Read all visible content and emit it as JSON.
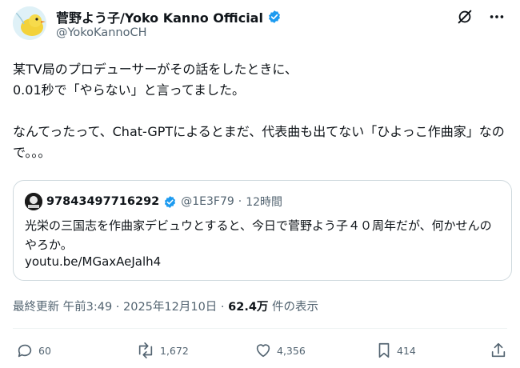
{
  "author": {
    "display_name": "菅野よう子/Yoko Kanno Official",
    "handle": "@YokoKannoCH",
    "avatar_icon": "yellow-bird-avatar",
    "verified_color": "#1d9bf0"
  },
  "header_icons": [
    "grok-icon",
    "more-icon"
  ],
  "post": {
    "text": "某TV局のプロデューサーがその話をしたときに、\n0.01秒で「やらない」と言ってました。\n\nなんてったって、Chat-GPTによるとまだ、代表曲も出てない「ひよっこ作曲家」なので。。。"
  },
  "quote": {
    "display_name": "97843497716292",
    "handle": "@1E3F79",
    "separator": "·",
    "time": "12時間",
    "text": "光栄の三国志を作曲家デビュウとすると、今日で菅野よう子４０周年だが、何かせんのやろか。",
    "link": "youtu.be/MGaxAeJalh4"
  },
  "meta": {
    "timestamp": "最終更新 午前3:49 · 2025年12月10日 · ",
    "views": "62.4万",
    "views_label": " 件の表示"
  },
  "actions": {
    "reply": "60",
    "repost": "1,672",
    "like": "4,356",
    "bookmark": "414"
  },
  "colors": {
    "text": "#0f1419",
    "secondary": "#536471",
    "border": "#cfd9de"
  }
}
